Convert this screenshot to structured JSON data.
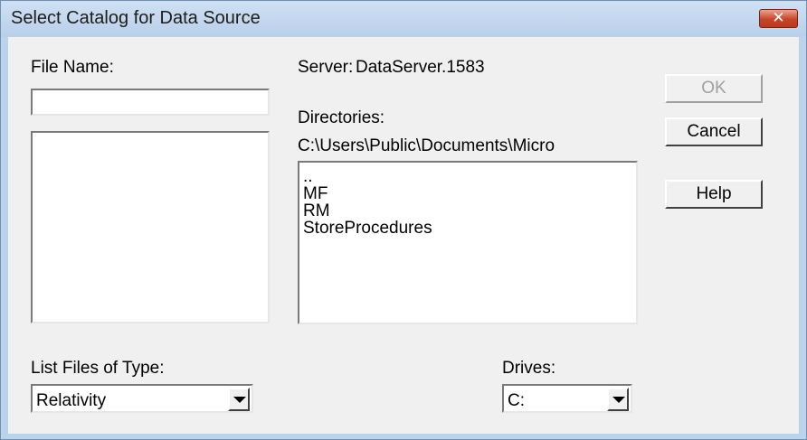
{
  "window": {
    "title": "Select Catalog for Data Source",
    "close_symbol": "✕"
  },
  "file_name": {
    "label": "File Name:",
    "value": "",
    "files": []
  },
  "server": {
    "label": "Server:",
    "value": "DataServer.1583"
  },
  "directories": {
    "label": "Directories:",
    "path": "C:\\Users\\Public\\Documents\\Micro",
    "items": [
      "..",
      "MF",
      "RM",
      "StoreProcedures"
    ]
  },
  "buttons": {
    "ok": "OK",
    "cancel": "Cancel",
    "help": "Help"
  },
  "file_type": {
    "label": "List Files of Type:",
    "selected": "Relativity"
  },
  "drives": {
    "label": "Drives:",
    "selected": "C:"
  },
  "colors": {
    "titlebar": "#bcd3ec",
    "dialog_bg": "#f0f0f0",
    "close_button": "#c7452a"
  }
}
